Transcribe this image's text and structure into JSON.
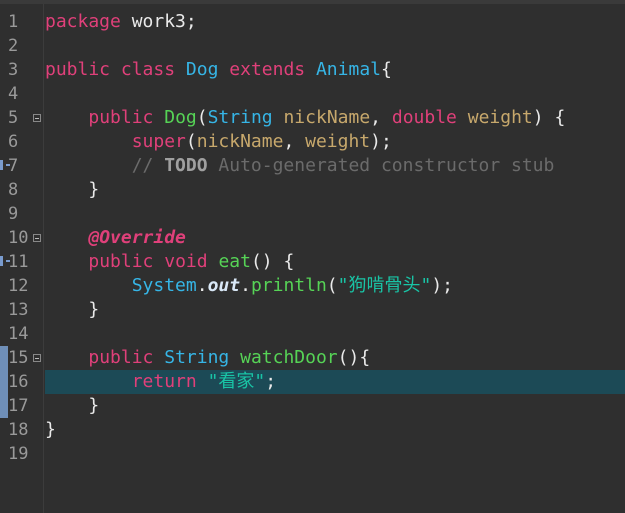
{
  "editor": {
    "lines": [
      {
        "n": "1",
        "tokens": [
          {
            "cls": "k",
            "text": "package"
          },
          {
            "cls": "m",
            "text": " work3;"
          }
        ]
      },
      {
        "n": "2",
        "tokens": []
      },
      {
        "n": "3",
        "tokens": [
          {
            "cls": "k",
            "text": "public"
          },
          {
            "cls": "m",
            "text": " "
          },
          {
            "cls": "k",
            "text": "class"
          },
          {
            "cls": "m",
            "text": " "
          },
          {
            "cls": "t",
            "text": "Dog"
          },
          {
            "cls": "m",
            "text": " "
          },
          {
            "cls": "k",
            "text": "extends"
          },
          {
            "cls": "m",
            "text": " "
          },
          {
            "cls": "t",
            "text": "Animal"
          },
          {
            "cls": "m",
            "text": "{"
          }
        ]
      },
      {
        "n": "4",
        "tokens": []
      },
      {
        "n": "5",
        "tokens": [
          {
            "cls": "m",
            "text": "    "
          },
          {
            "cls": "k",
            "text": "public"
          },
          {
            "cls": "m",
            "text": " "
          },
          {
            "cls": "f",
            "text": "Dog"
          },
          {
            "cls": "m",
            "text": "("
          },
          {
            "cls": "t",
            "text": "String"
          },
          {
            "cls": "m",
            "text": " "
          },
          {
            "cls": "p",
            "text": "nickName"
          },
          {
            "cls": "m",
            "text": ", "
          },
          {
            "cls": "k",
            "text": "double"
          },
          {
            "cls": "m",
            "text": " "
          },
          {
            "cls": "p",
            "text": "weight"
          },
          {
            "cls": "m",
            "text": ") {"
          }
        ]
      },
      {
        "n": "6",
        "tokens": [
          {
            "cls": "m",
            "text": "        "
          },
          {
            "cls": "k",
            "text": "super"
          },
          {
            "cls": "m",
            "text": "("
          },
          {
            "cls": "p",
            "text": "nickName"
          },
          {
            "cls": "m",
            "text": ", "
          },
          {
            "cls": "p",
            "text": "weight"
          },
          {
            "cls": "m",
            "text": ");"
          }
        ]
      },
      {
        "n": "7",
        "tokens": [
          {
            "cls": "m",
            "text": "        "
          },
          {
            "cls": "c",
            "text": "// "
          },
          {
            "cls": "todo",
            "text": "TODO"
          },
          {
            "cls": "c",
            "text": " Auto-generated constructor stub"
          }
        ]
      },
      {
        "n": "8",
        "tokens": [
          {
            "cls": "m",
            "text": "    }"
          }
        ]
      },
      {
        "n": "9",
        "tokens": []
      },
      {
        "n": "10",
        "tokens": [
          {
            "cls": "m",
            "text": "    "
          },
          {
            "cls": "a",
            "text": "@Override"
          }
        ]
      },
      {
        "n": "11",
        "tokens": [
          {
            "cls": "m",
            "text": "    "
          },
          {
            "cls": "k",
            "text": "public"
          },
          {
            "cls": "m",
            "text": " "
          },
          {
            "cls": "k",
            "text": "void"
          },
          {
            "cls": "m",
            "text": " "
          },
          {
            "cls": "f",
            "text": "eat"
          },
          {
            "cls": "m",
            "text": "() {"
          }
        ]
      },
      {
        "n": "12",
        "tokens": [
          {
            "cls": "m",
            "text": "        "
          },
          {
            "cls": "t",
            "text": "System"
          },
          {
            "cls": "m",
            "text": "."
          },
          {
            "cls": "st",
            "text": "out"
          },
          {
            "cls": "m",
            "text": "."
          },
          {
            "cls": "f",
            "text": "println"
          },
          {
            "cls": "m",
            "text": "("
          },
          {
            "cls": "s",
            "text": "\"狗啃骨头\""
          },
          {
            "cls": "m",
            "text": ");"
          }
        ]
      },
      {
        "n": "13",
        "tokens": [
          {
            "cls": "m",
            "text": "    }"
          }
        ]
      },
      {
        "n": "14",
        "tokens": []
      },
      {
        "n": "15",
        "tokens": [
          {
            "cls": "m",
            "text": "    "
          },
          {
            "cls": "k",
            "text": "public"
          },
          {
            "cls": "m",
            "text": " "
          },
          {
            "cls": "t",
            "text": "String"
          },
          {
            "cls": "m",
            "text": " "
          },
          {
            "cls": "f",
            "text": "watchDoor"
          },
          {
            "cls": "m",
            "text": "(){"
          }
        ]
      },
      {
        "n": "16",
        "tokens": [
          {
            "cls": "m",
            "text": "        "
          },
          {
            "cls": "k",
            "text": "return"
          },
          {
            "cls": "m",
            "text": " "
          },
          {
            "cls": "s",
            "text": "\"看家\""
          },
          {
            "cls": "m",
            "text": ";"
          }
        ]
      },
      {
        "n": "17",
        "tokens": [
          {
            "cls": "m",
            "text": "    }"
          }
        ]
      },
      {
        "n": "18",
        "tokens": [
          {
            "cls": "m",
            "text": "}"
          }
        ]
      },
      {
        "n": "19",
        "tokens": []
      }
    ],
    "highlighted_line": 16,
    "fold_lines": [
      5,
      10,
      15
    ],
    "changed_lines": [
      15,
      16,
      17
    ],
    "gutter_icons": [
      {
        "line": 7,
        "name": "task-marker-icon",
        "color": "#7a9ccf"
      },
      {
        "line": 11,
        "name": "override-marker-icon",
        "color": "#7a9ccf"
      }
    ],
    "colors": {
      "background": "#2f2f2f",
      "keyword": "#e0407a",
      "type": "#36b5e6",
      "method": "#56d356",
      "parameter": "#c7a86c",
      "string": "#19c4a6",
      "comment": "#6b6b6b",
      "current_line": "#1c4a56"
    }
  }
}
